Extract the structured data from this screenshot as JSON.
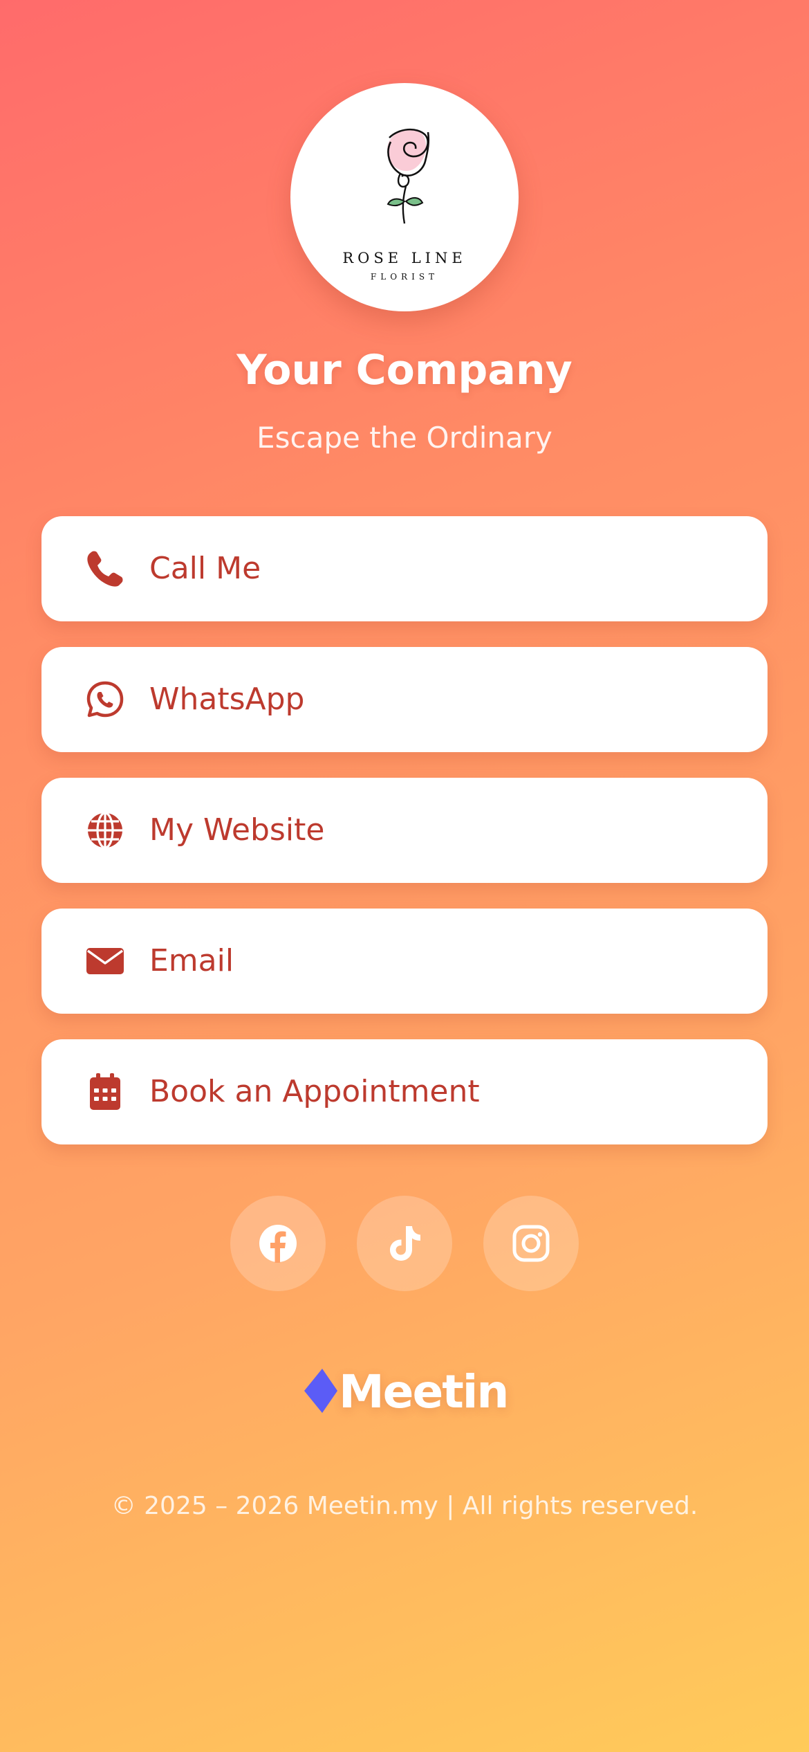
{
  "logo": {
    "title": "ROSE LINE",
    "subtitle": "FLORIST",
    "icon": "rose-icon"
  },
  "profile": {
    "company": "Your Company",
    "tagline": "Escape the Ordinary"
  },
  "links": [
    {
      "label": "Call Me",
      "icon": "phone-icon"
    },
    {
      "label": "WhatsApp",
      "icon": "whatsapp-icon"
    },
    {
      "label": "My Website",
      "icon": "globe-icon"
    },
    {
      "label": "Email",
      "icon": "envelope-icon"
    },
    {
      "label": "Book an Appointment",
      "icon": "calendar-icon"
    }
  ],
  "social": [
    {
      "icon": "facebook-icon"
    },
    {
      "icon": "tiktok-icon"
    },
    {
      "icon": "instagram-icon"
    }
  ],
  "brand": {
    "name": "Meetin",
    "mark_color": "#5b5cf6"
  },
  "footer": {
    "text": "© 2025 – 2026 Meetin.my | All rights reserved."
  },
  "colors": {
    "accent": "#bd3a2e",
    "gradient_start": "#ff6b6b",
    "gradient_end": "#ffcb5a",
    "button_bg": "#ffffff"
  }
}
